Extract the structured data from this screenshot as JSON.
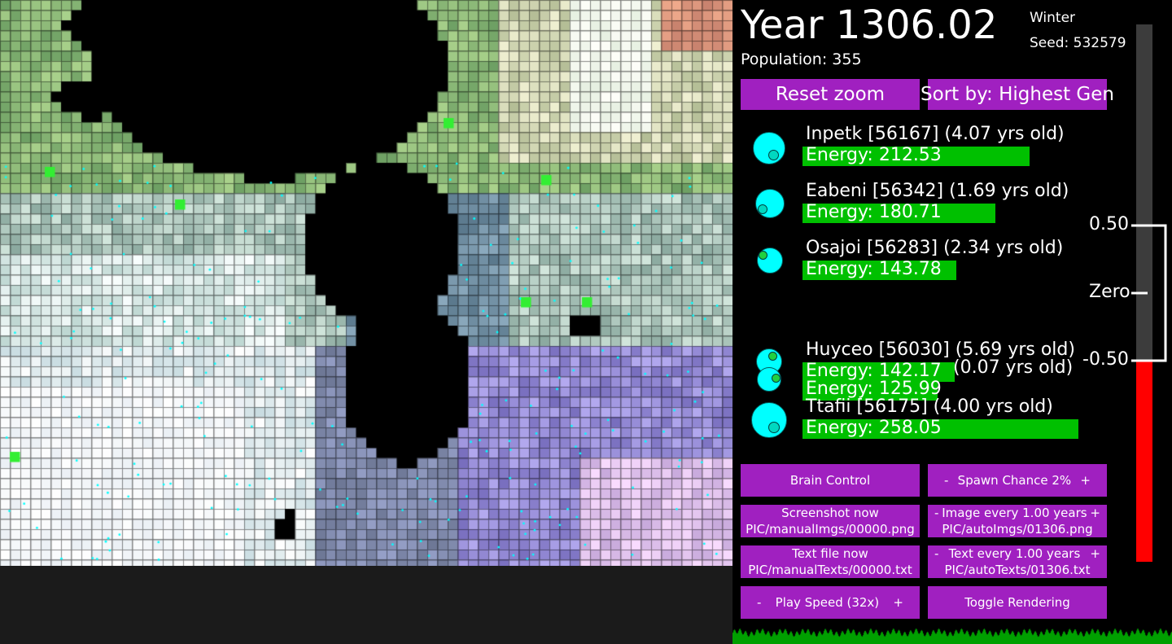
{
  "header": {
    "year": "Year 1306.02",
    "population": "Population: 355",
    "season": "Winter",
    "seed": "Seed: 532579"
  },
  "top_buttons": {
    "reset_zoom": "Reset zoom",
    "sort_by": "Sort by: Highest Gen"
  },
  "creatures": [
    {
      "name": "Inpetk [56167] (4.07 yrs old)",
      "energy_label": "Energy: 212.53",
      "energy": 212.53
    },
    {
      "name": "Eabeni [56342] (1.69 yrs old)",
      "energy_label": "Energy: 180.71",
      "energy": 180.71
    },
    {
      "name": "Osajoi [56283] (2.34 yrs old)",
      "energy_label": "Energy: 143.78",
      "energy": 143.78
    },
    {
      "name": "Huyceo [56030] (5.69 yrs old)",
      "energy_label": "Energy: 142.17",
      "energy": 142.17
    },
    {
      "name": "(0.07 yrs old)",
      "energy_label": "Energy: 125.99",
      "energy": 125.99
    },
    {
      "name": "Ttafii [56175] (4.00 yrs old)",
      "energy_label": "Energy: 258.05",
      "energy": 258.05
    }
  ],
  "controls": {
    "brain_control": "Brain Control",
    "spawn_minus": "-",
    "spawn_label": "Spawn Chance 2%",
    "spawn_plus": "+",
    "screenshot_title": "Screenshot now",
    "screenshot_path": "PIC/manualImgs/00000.png",
    "image_minus": "-",
    "image_label": "Image every 1.00 years",
    "image_plus": "+",
    "image_path": "PIC/autoImgs/01306.png",
    "textfile_title": "Text file now",
    "textfile_path": "PIC/manualTexts/00000.txt",
    "text_minus": "-",
    "text_label": "Text every 1.00 years",
    "text_plus": "+",
    "text_path": "PIC/autoTexts/01306.txt",
    "speed_minus": "-",
    "speed_label": "Play Speed (32x)",
    "speed_plus": "+",
    "toggle_rendering": "Toggle Rendering"
  },
  "meter": {
    "top_label": "0.50",
    "mid_label": "Zero",
    "bottom_label": "-0.50",
    "fill_fraction": 0.374,
    "fill_color": "#ff0000"
  },
  "colors": {
    "button": "#a020c0",
    "energy_bar": "#00c000",
    "creature": "#00ffff"
  }
}
